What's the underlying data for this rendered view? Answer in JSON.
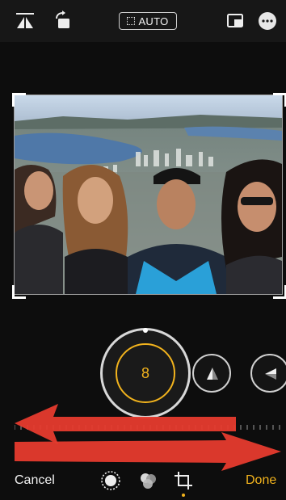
{
  "toolbar": {
    "auto_label": "AUTO",
    "icons": [
      "flip-perspective-icon",
      "rotate-icon",
      "aspect-ratio-icon",
      "more-icon"
    ]
  },
  "adjustment": {
    "dial_value": "8",
    "tools": [
      "perspective-vertical-icon",
      "perspective-horizontal-icon"
    ]
  },
  "bottom": {
    "cancel_label": "Cancel",
    "done_label": "Done",
    "icons": [
      "adjust-icon",
      "filters-icon",
      "crop-icon"
    ]
  },
  "colors": {
    "accent": "#f2b31d",
    "arrow": "#e63b2e",
    "background": "#0d0d0d"
  }
}
